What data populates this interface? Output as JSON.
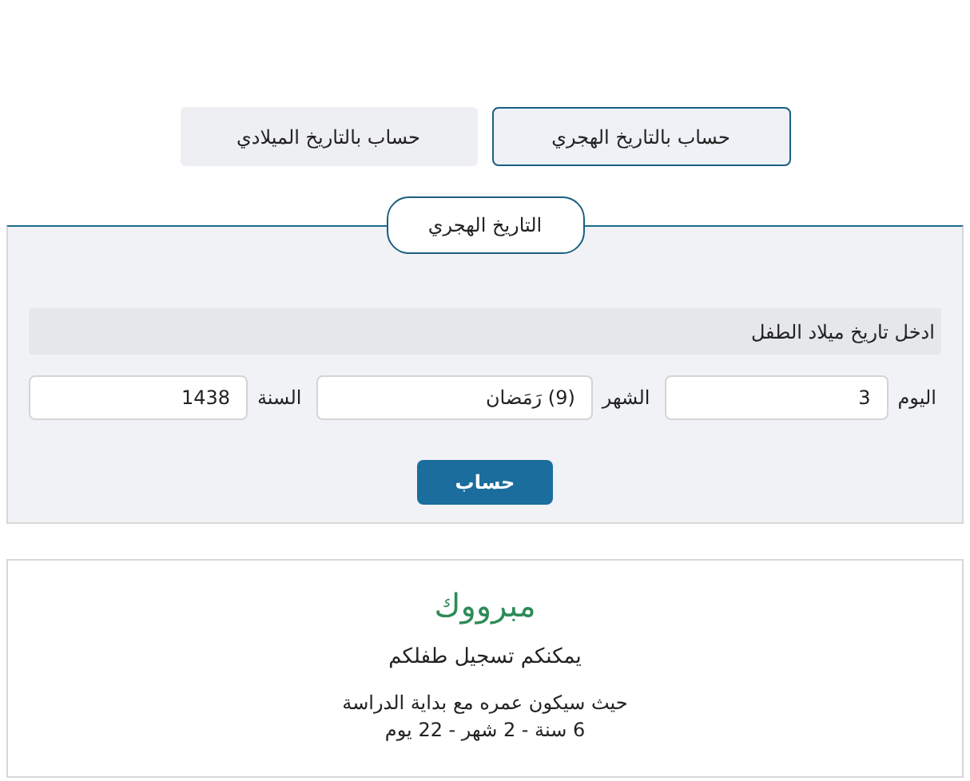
{
  "tabs": [
    {
      "label": "حساب بالتاريخ الهجري",
      "selected": true
    },
    {
      "label": "حساب بالتاريخ الميلادي",
      "selected": false
    }
  ],
  "panel": {
    "legend": "التاريخ الهجري",
    "instruction": "ادخل تاريخ ميلاد الطفل",
    "fields": [
      {
        "label": "اليوم",
        "value": "3"
      },
      {
        "label": "الشهر",
        "value": "(9) رَمَضان"
      },
      {
        "label": "السنة",
        "value": "1438"
      }
    ],
    "button": "حساب"
  },
  "result": {
    "title": "مبرووك",
    "subtitle": "يمكنكم تسجيل طفلكم",
    "lines": [
      "حيث سيكون عمره مع بداية الدراسة",
      "6 سنة - 2 شهر - 22 يوم"
    ]
  }
}
